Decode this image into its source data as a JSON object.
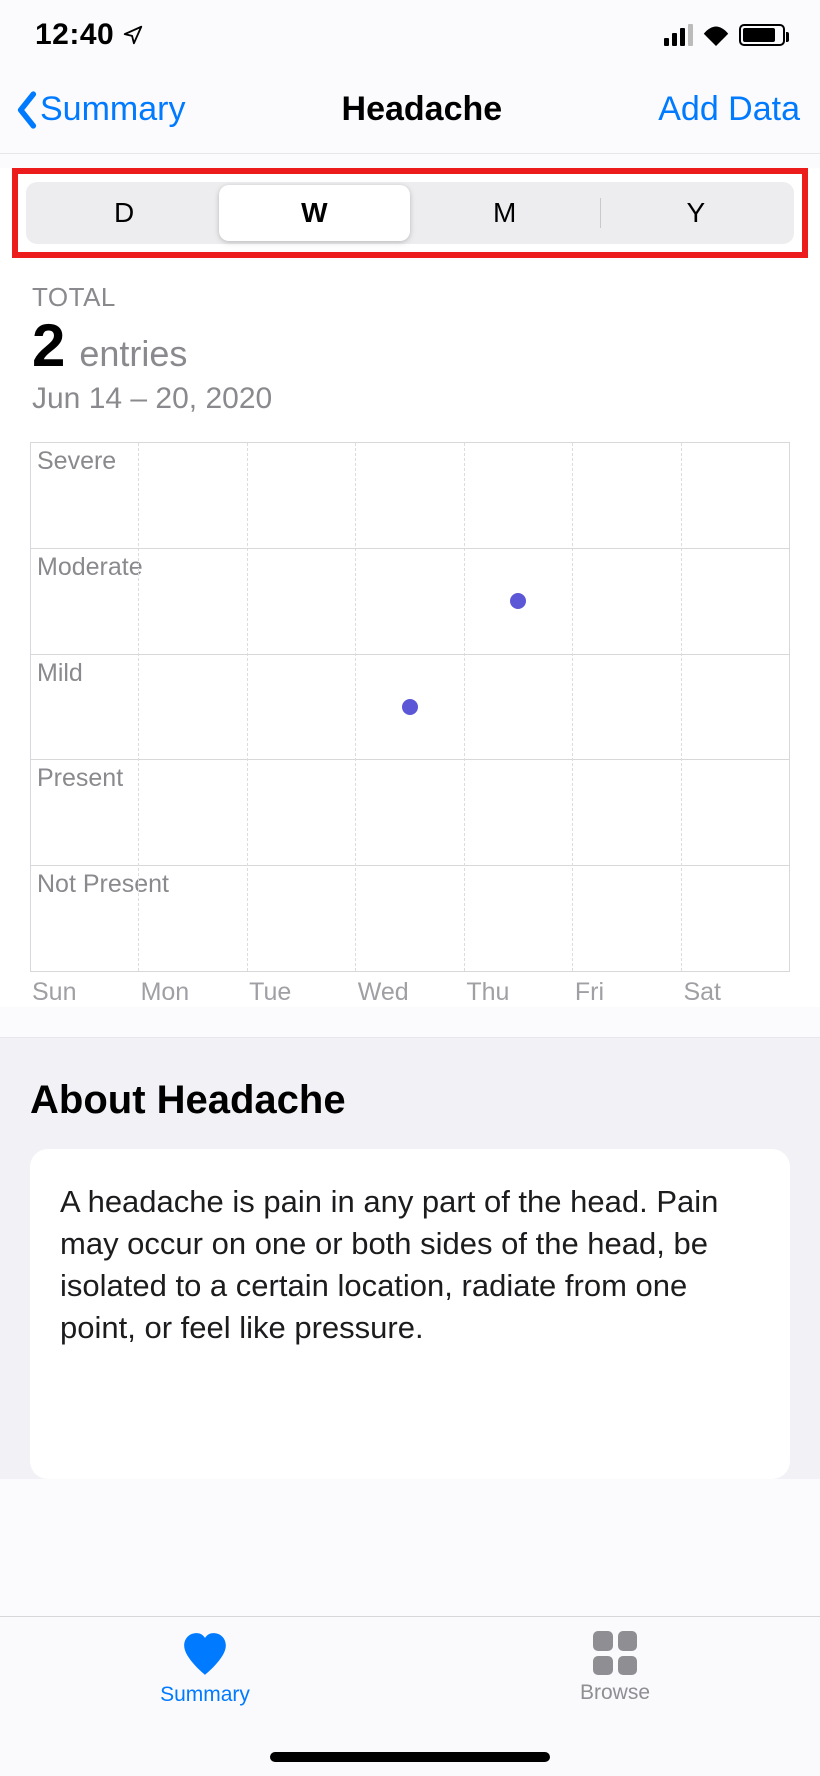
{
  "status": {
    "time": "12:40"
  },
  "nav": {
    "back_label": "Summary",
    "title": "Headache",
    "action_label": "Add Data"
  },
  "segmented": {
    "items": [
      "D",
      "W",
      "M",
      "Y"
    ],
    "selected_index": 1
  },
  "summary": {
    "total_label": "TOTAL",
    "count": "2",
    "unit": "entries",
    "date_range": "Jun 14 – 20, 2020"
  },
  "chart_data": {
    "type": "scatter",
    "categories": [
      "Sun",
      "Mon",
      "Tue",
      "Wed",
      "Thu",
      "Fri",
      "Sat"
    ],
    "y_levels": [
      "Severe",
      "Moderate",
      "Mild",
      "Present",
      "Not Present"
    ],
    "points": [
      {
        "x": "Wed",
        "y": "Mild"
      },
      {
        "x": "Thu",
        "y": "Moderate"
      }
    ],
    "point_color": "#5b57d6"
  },
  "about": {
    "heading": "About Headache",
    "body": "A headache is pain in any part of the head. Pain may occur on one or both sides of the head, be isolated to a certain location, radiate from one point, or feel like pressure."
  },
  "tabs": {
    "items": [
      {
        "icon": "heart",
        "label": "Summary",
        "active": true
      },
      {
        "icon": "grid",
        "label": "Browse",
        "active": false
      }
    ]
  }
}
